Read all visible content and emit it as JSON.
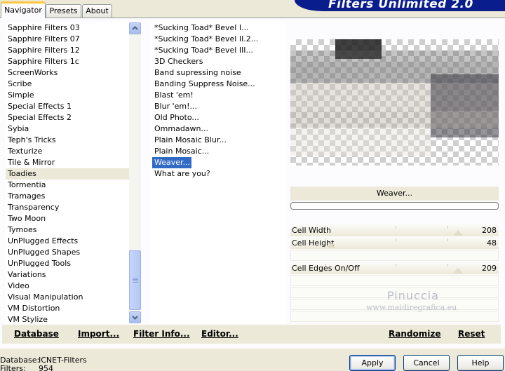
{
  "tabs": [
    "Navigator",
    "Presets",
    "About"
  ],
  "banner_title": "Filters Unlimited 2.0",
  "categories": [
    "Sapphire Filters 03",
    "Sapphire Filters 07",
    "Sapphire Filters 12",
    "Sapphire Filters 1c",
    "ScreenWorks",
    "Scribe",
    "Simple",
    "Special Effects 1",
    "Special Effects 2",
    "Sybia",
    "Teph's Tricks",
    "Texturize",
    "Tile & Mirror",
    "Toadies",
    "Tormentia",
    "Tramages",
    "Transparency",
    "Two Moon",
    "Tymoes",
    "UnPlugged Effects",
    "UnPlugged Shapes",
    "UnPlugged Tools",
    "Variations",
    "Video",
    "Visual Manipulation",
    "VM Distortion",
    "VM Stylize"
  ],
  "selected_category": "Toadies",
  "filters": [
    "*Sucking Toad*  Bevel I...",
    "*Sucking Toad*  Bevel II.2...",
    "*Sucking Toad*  Bevel III...",
    "3D Checkers",
    "Band supressing noise",
    "Banding Suppress Noise...",
    "Blast 'em!",
    "Blur 'em!...",
    "Old Photo...",
    "Ommadawn...",
    "Plain Mosaic Blur...",
    "Plain Mosaic...",
    "Weaver...",
    "What are you?"
  ],
  "selected_filter": "Weaver...",
  "filter_title": "Weaver...",
  "params": [
    {
      "label": "Cell Width",
      "value": "208",
      "level": 0.82
    },
    {
      "label": "Cell Height",
      "value": "48",
      "level": 0.19
    },
    {
      "label": "Cell Edges On/Off",
      "value": "209",
      "level": 0.82
    }
  ],
  "watermark": {
    "name": "Pinuccia",
    "site": "www.maidiregrafica.eu"
  },
  "toolbar_left": [
    "Database",
    "Import...",
    "Filter Info...",
    "Editor..."
  ],
  "toolbar_right": [
    "Randomize",
    "Reset"
  ],
  "status": {
    "database_label": "Database:",
    "database_value": "ICNET-Filters",
    "filters_label": "Filters:",
    "filters_value": "954"
  },
  "buttons": [
    "Apply",
    "Cancel",
    "Help"
  ]
}
